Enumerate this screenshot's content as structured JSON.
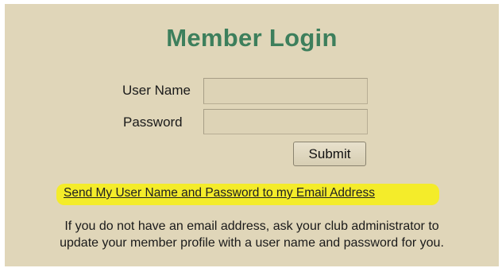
{
  "login": {
    "title": "Member Login",
    "user_name_label": "User Name",
    "password_label": "Password",
    "user_name_value": "",
    "password_value": "",
    "submit_label": "Submit",
    "send_link": "Send My User Name and Password to my Email Address",
    "info_line1": "If you do not have an email address, ask your club administrator to",
    "info_line2": "update your member profile with a user name and password for you."
  },
  "colors": {
    "panel_background": "#e0d6b9",
    "title": "#3d7f5c",
    "link_highlight": "#f4ec2a"
  }
}
